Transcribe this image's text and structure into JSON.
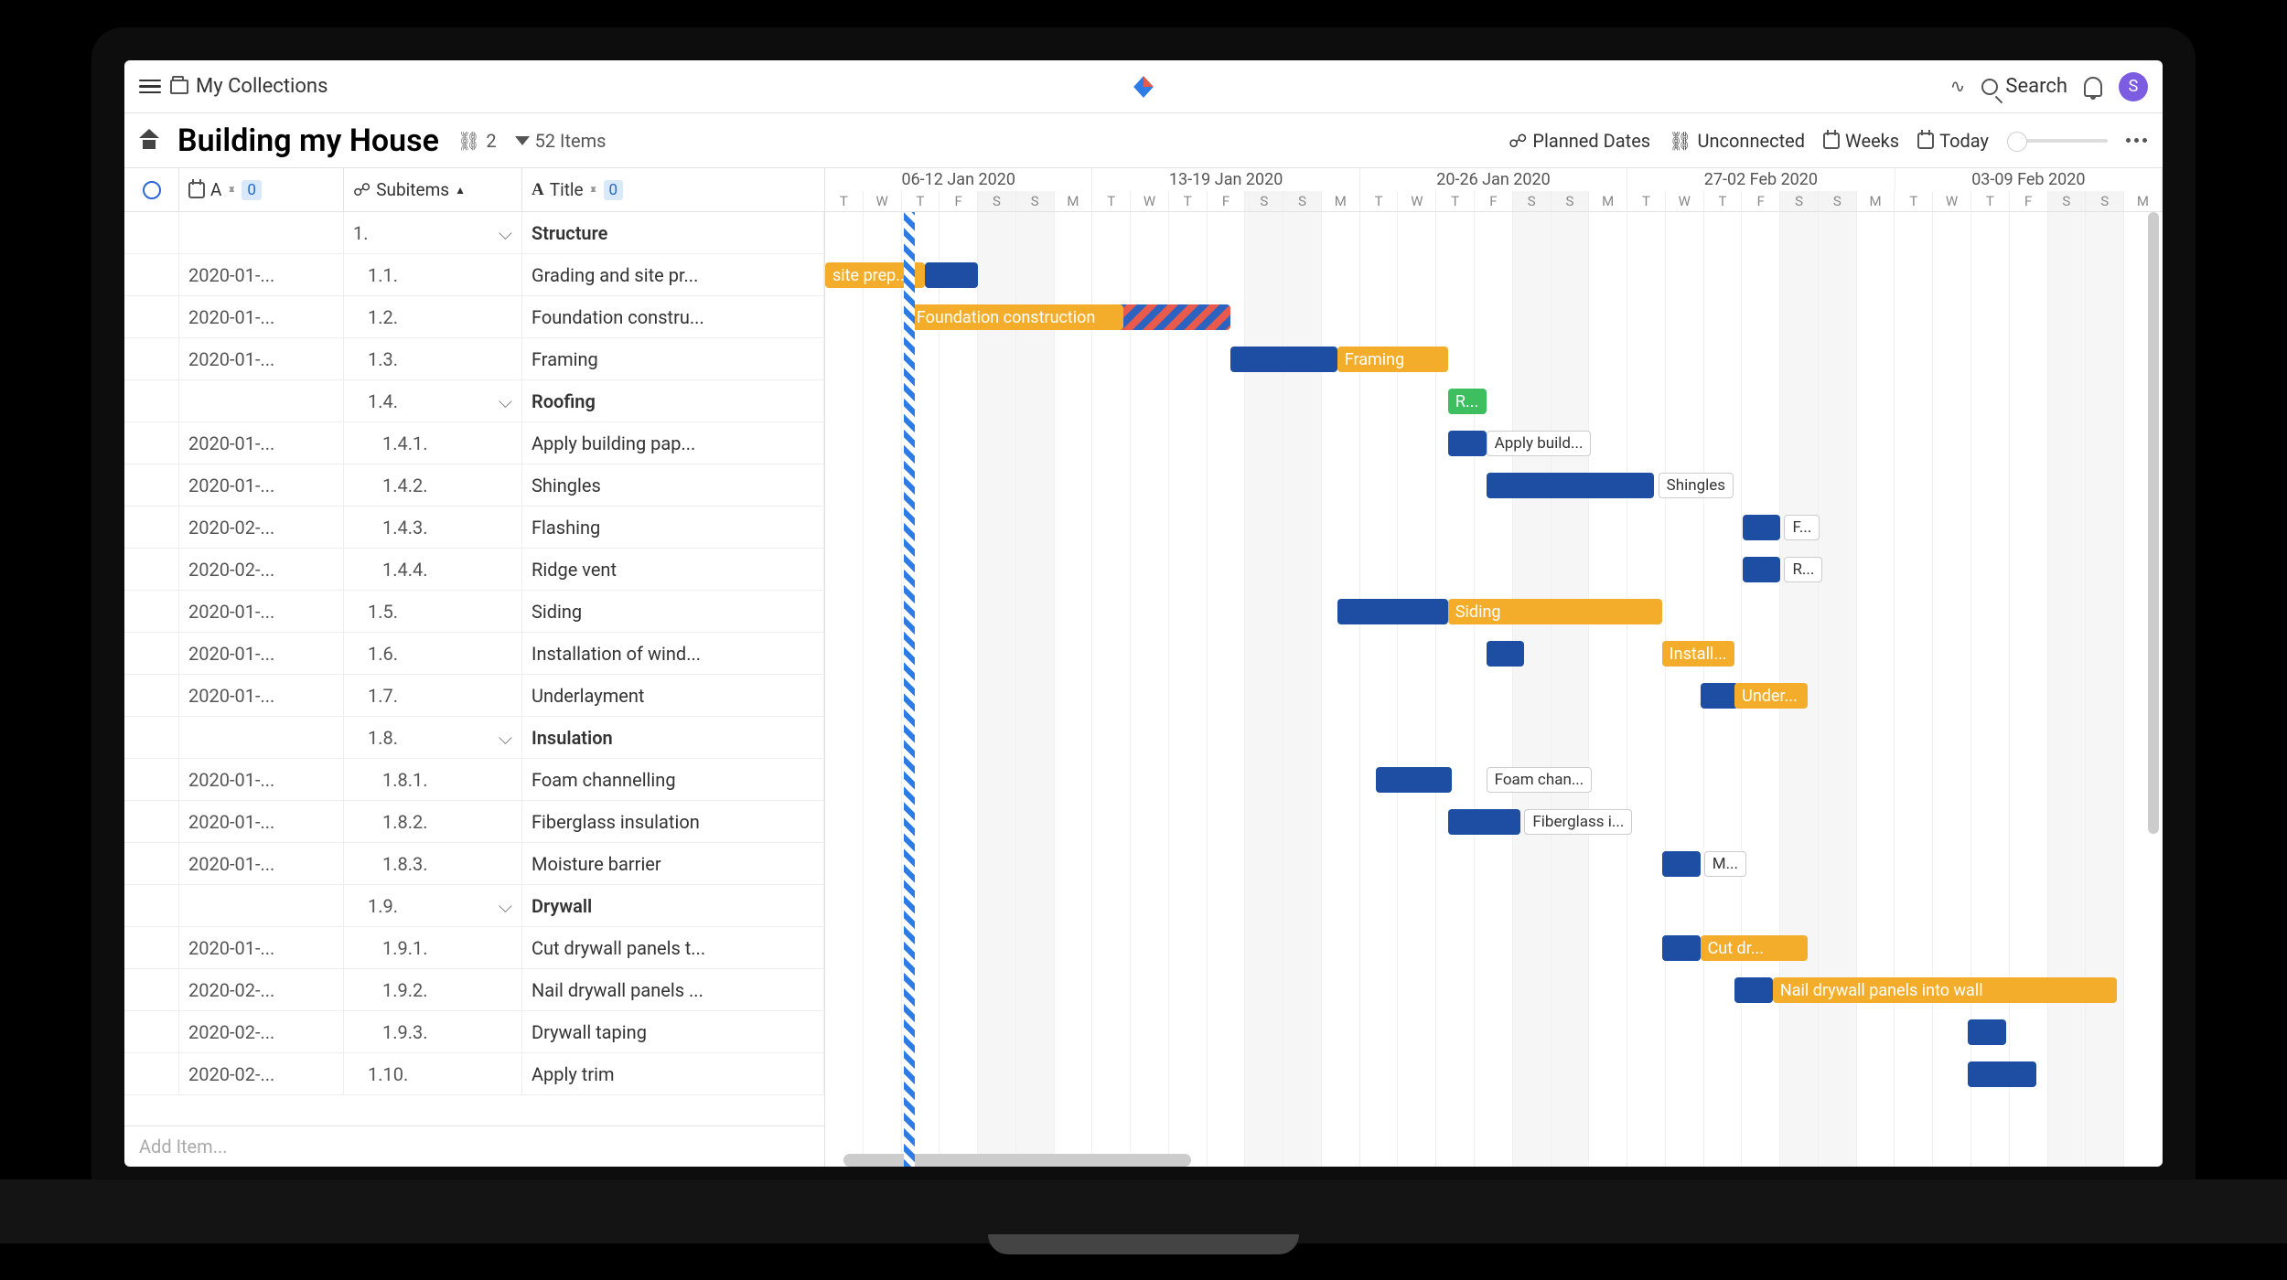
{
  "toolbar": {
    "breadcrumb": "My Collections",
    "search_label": "Search",
    "avatar_initial": "S"
  },
  "viewbar": {
    "title": "Building my House",
    "link_count": "2",
    "filter_label": "52 Items",
    "planned_dates": "Planned Dates",
    "unconnected": "Unconnected",
    "weeks": "Weeks",
    "today": "Today"
  },
  "columns": {
    "date_label": "A",
    "date_badge": "0",
    "subitems_label": "Subitems",
    "title_label": "Title",
    "title_badge": "0"
  },
  "rows": [
    {
      "date": "",
      "sub": "1.",
      "chev": true,
      "title": "Structure",
      "bold": true
    },
    {
      "date": "2020-01-...",
      "sub": "1.1.",
      "title": "Grading and site pr..."
    },
    {
      "date": "2020-01-...",
      "sub": "1.2.",
      "title": "Foundation constru..."
    },
    {
      "date": "2020-01-...",
      "sub": "1.3.",
      "title": "Framing"
    },
    {
      "date": "",
      "sub": "1.4.",
      "chev": true,
      "title": "Roofing",
      "bold": true
    },
    {
      "date": "2020-01-...",
      "sub": "1.4.1.",
      "title": "Apply building pap..."
    },
    {
      "date": "2020-01-...",
      "sub": "1.4.2.",
      "title": "Shingles"
    },
    {
      "date": "2020-02-...",
      "sub": "1.4.3.",
      "title": "Flashing"
    },
    {
      "date": "2020-02-...",
      "sub": "1.4.4.",
      "title": "Ridge vent"
    },
    {
      "date": "2020-01-...",
      "sub": "1.5.",
      "title": "Siding"
    },
    {
      "date": "2020-01-...",
      "sub": "1.6.",
      "title": "Installation of wind..."
    },
    {
      "date": "2020-01-...",
      "sub": "1.7.",
      "title": "Underlayment"
    },
    {
      "date": "",
      "sub": "1.8.",
      "chev": true,
      "title": "Insulation",
      "bold": true
    },
    {
      "date": "2020-01-...",
      "sub": "1.8.1.",
      "title": "Foam channelling"
    },
    {
      "date": "2020-01-...",
      "sub": "1.8.2.",
      "title": "Fiberglass insulation"
    },
    {
      "date": "2020-01-...",
      "sub": "1.8.3.",
      "title": "Moisture barrier"
    },
    {
      "date": "",
      "sub": "1.9.",
      "chev": true,
      "title": "Drywall",
      "bold": true
    },
    {
      "date": "2020-01-...",
      "sub": "1.9.1.",
      "title": "Cut drywall panels t..."
    },
    {
      "date": "2020-02-...",
      "sub": "1.9.2.",
      "title": "Nail drywall panels ..."
    },
    {
      "date": "2020-02-...",
      "sub": "1.9.3.",
      "title": "Drywall taping"
    },
    {
      "date": "2020-02-...",
      "sub": "1.10.",
      "title": "Apply trim"
    }
  ],
  "add_item_placeholder": "Add Item...",
  "timeline": {
    "weeks": [
      "06-12 Jan 2020",
      "13-19 Jan 2020",
      "20-26 Jan 2020",
      "27-02 Feb 2020",
      "03-09 Feb 2020"
    ],
    "days": [
      "T",
      "W",
      "T",
      "F",
      "S",
      "S",
      "M",
      "T",
      "W",
      "T",
      "F",
      "S",
      "S",
      "M",
      "T",
      "W",
      "T",
      "F",
      "S",
      "S",
      "M",
      "T",
      "W",
      "T",
      "F",
      "S",
      "S",
      "M",
      "T",
      "W",
      "T",
      "F",
      "S",
      "S",
      "M"
    ]
  },
  "bars": [
    {
      "row": 1,
      "start": 0,
      "span": 2.6,
      "cls": "yellow",
      "label": "site prep..."
    },
    {
      "row": 1,
      "start": 2.6,
      "span": 1.4,
      "cls": "blue",
      "label": ""
    },
    {
      "row": 2,
      "start": 2.2,
      "span": 8.4,
      "cls": "hatch",
      "label": ""
    },
    {
      "row": 2,
      "start": 2.2,
      "span": 5.6,
      "cls": "yellow",
      "label": "Foundation construction"
    },
    {
      "row": 3,
      "start": 10.6,
      "span": 2.8,
      "cls": "blue",
      "label": ""
    },
    {
      "row": 3,
      "start": 13.4,
      "span": 2.9,
      "cls": "yellow",
      "label": "Framing"
    },
    {
      "row": 4,
      "start": 16.3,
      "span": 1,
      "cls": "green",
      "label": "R..."
    },
    {
      "row": 5,
      "start": 16.3,
      "span": 1,
      "cls": "blue",
      "label": ""
    },
    {
      "row": 6,
      "start": 17.3,
      "span": 4.4,
      "cls": "blue",
      "label": ""
    },
    {
      "row": 7,
      "start": 24,
      "span": 1,
      "cls": "blue",
      "label": ""
    },
    {
      "row": 8,
      "start": 24,
      "span": 1,
      "cls": "blue",
      "label": ""
    },
    {
      "row": 9,
      "start": 13.4,
      "span": 2.9,
      "cls": "blue",
      "label": ""
    },
    {
      "row": 9,
      "start": 16.3,
      "span": 5.6,
      "cls": "yellow",
      "label": "Siding"
    },
    {
      "row": 10,
      "start": 17.3,
      "span": 1,
      "cls": "blue",
      "label": ""
    },
    {
      "row": 10,
      "start": 21.9,
      "span": 1.9,
      "cls": "yellow",
      "label": "Install..."
    },
    {
      "row": 11,
      "start": 22.9,
      "span": 1,
      "cls": "blue",
      "label": ""
    },
    {
      "row": 11,
      "start": 23.8,
      "span": 1.9,
      "cls": "yellow",
      "label": "Under..."
    },
    {
      "row": 13,
      "start": 14.4,
      "span": 2,
      "cls": "blue",
      "label": ""
    },
    {
      "row": 14,
      "start": 16.3,
      "span": 1.9,
      "cls": "blue",
      "label": ""
    },
    {
      "row": 15,
      "start": 21.9,
      "span": 1,
      "cls": "blue",
      "label": ""
    },
    {
      "row": 17,
      "start": 21.9,
      "span": 1,
      "cls": "blue",
      "label": ""
    },
    {
      "row": 17,
      "start": 22.9,
      "span": 2.8,
      "cls": "yellow",
      "label": "Cut dr..."
    },
    {
      "row": 18,
      "start": 23.8,
      "span": 1,
      "cls": "blue",
      "label": ""
    },
    {
      "row": 18,
      "start": 24.8,
      "span": 9,
      "cls": "yellow",
      "label": "Nail drywall panels into wall"
    },
    {
      "row": 19,
      "start": 29.9,
      "span": 1,
      "cls": "blue",
      "label": ""
    },
    {
      "row": 20,
      "start": 29.9,
      "span": 1.8,
      "cls": "blue",
      "label": ""
    }
  ],
  "labels": [
    {
      "row": 5,
      "start": 17.3,
      "text": "Apply build..."
    },
    {
      "row": 6,
      "start": 21.8,
      "text": "Shingles"
    },
    {
      "row": 7,
      "start": 25.1,
      "text": "F..."
    },
    {
      "row": 8,
      "start": 25.1,
      "text": "R..."
    },
    {
      "row": 13,
      "start": 17.3,
      "text": "Foam chan..."
    },
    {
      "row": 14,
      "start": 18.3,
      "text": "Fiberglass i..."
    },
    {
      "row": 15,
      "start": 23,
      "text": "M..."
    }
  ]
}
